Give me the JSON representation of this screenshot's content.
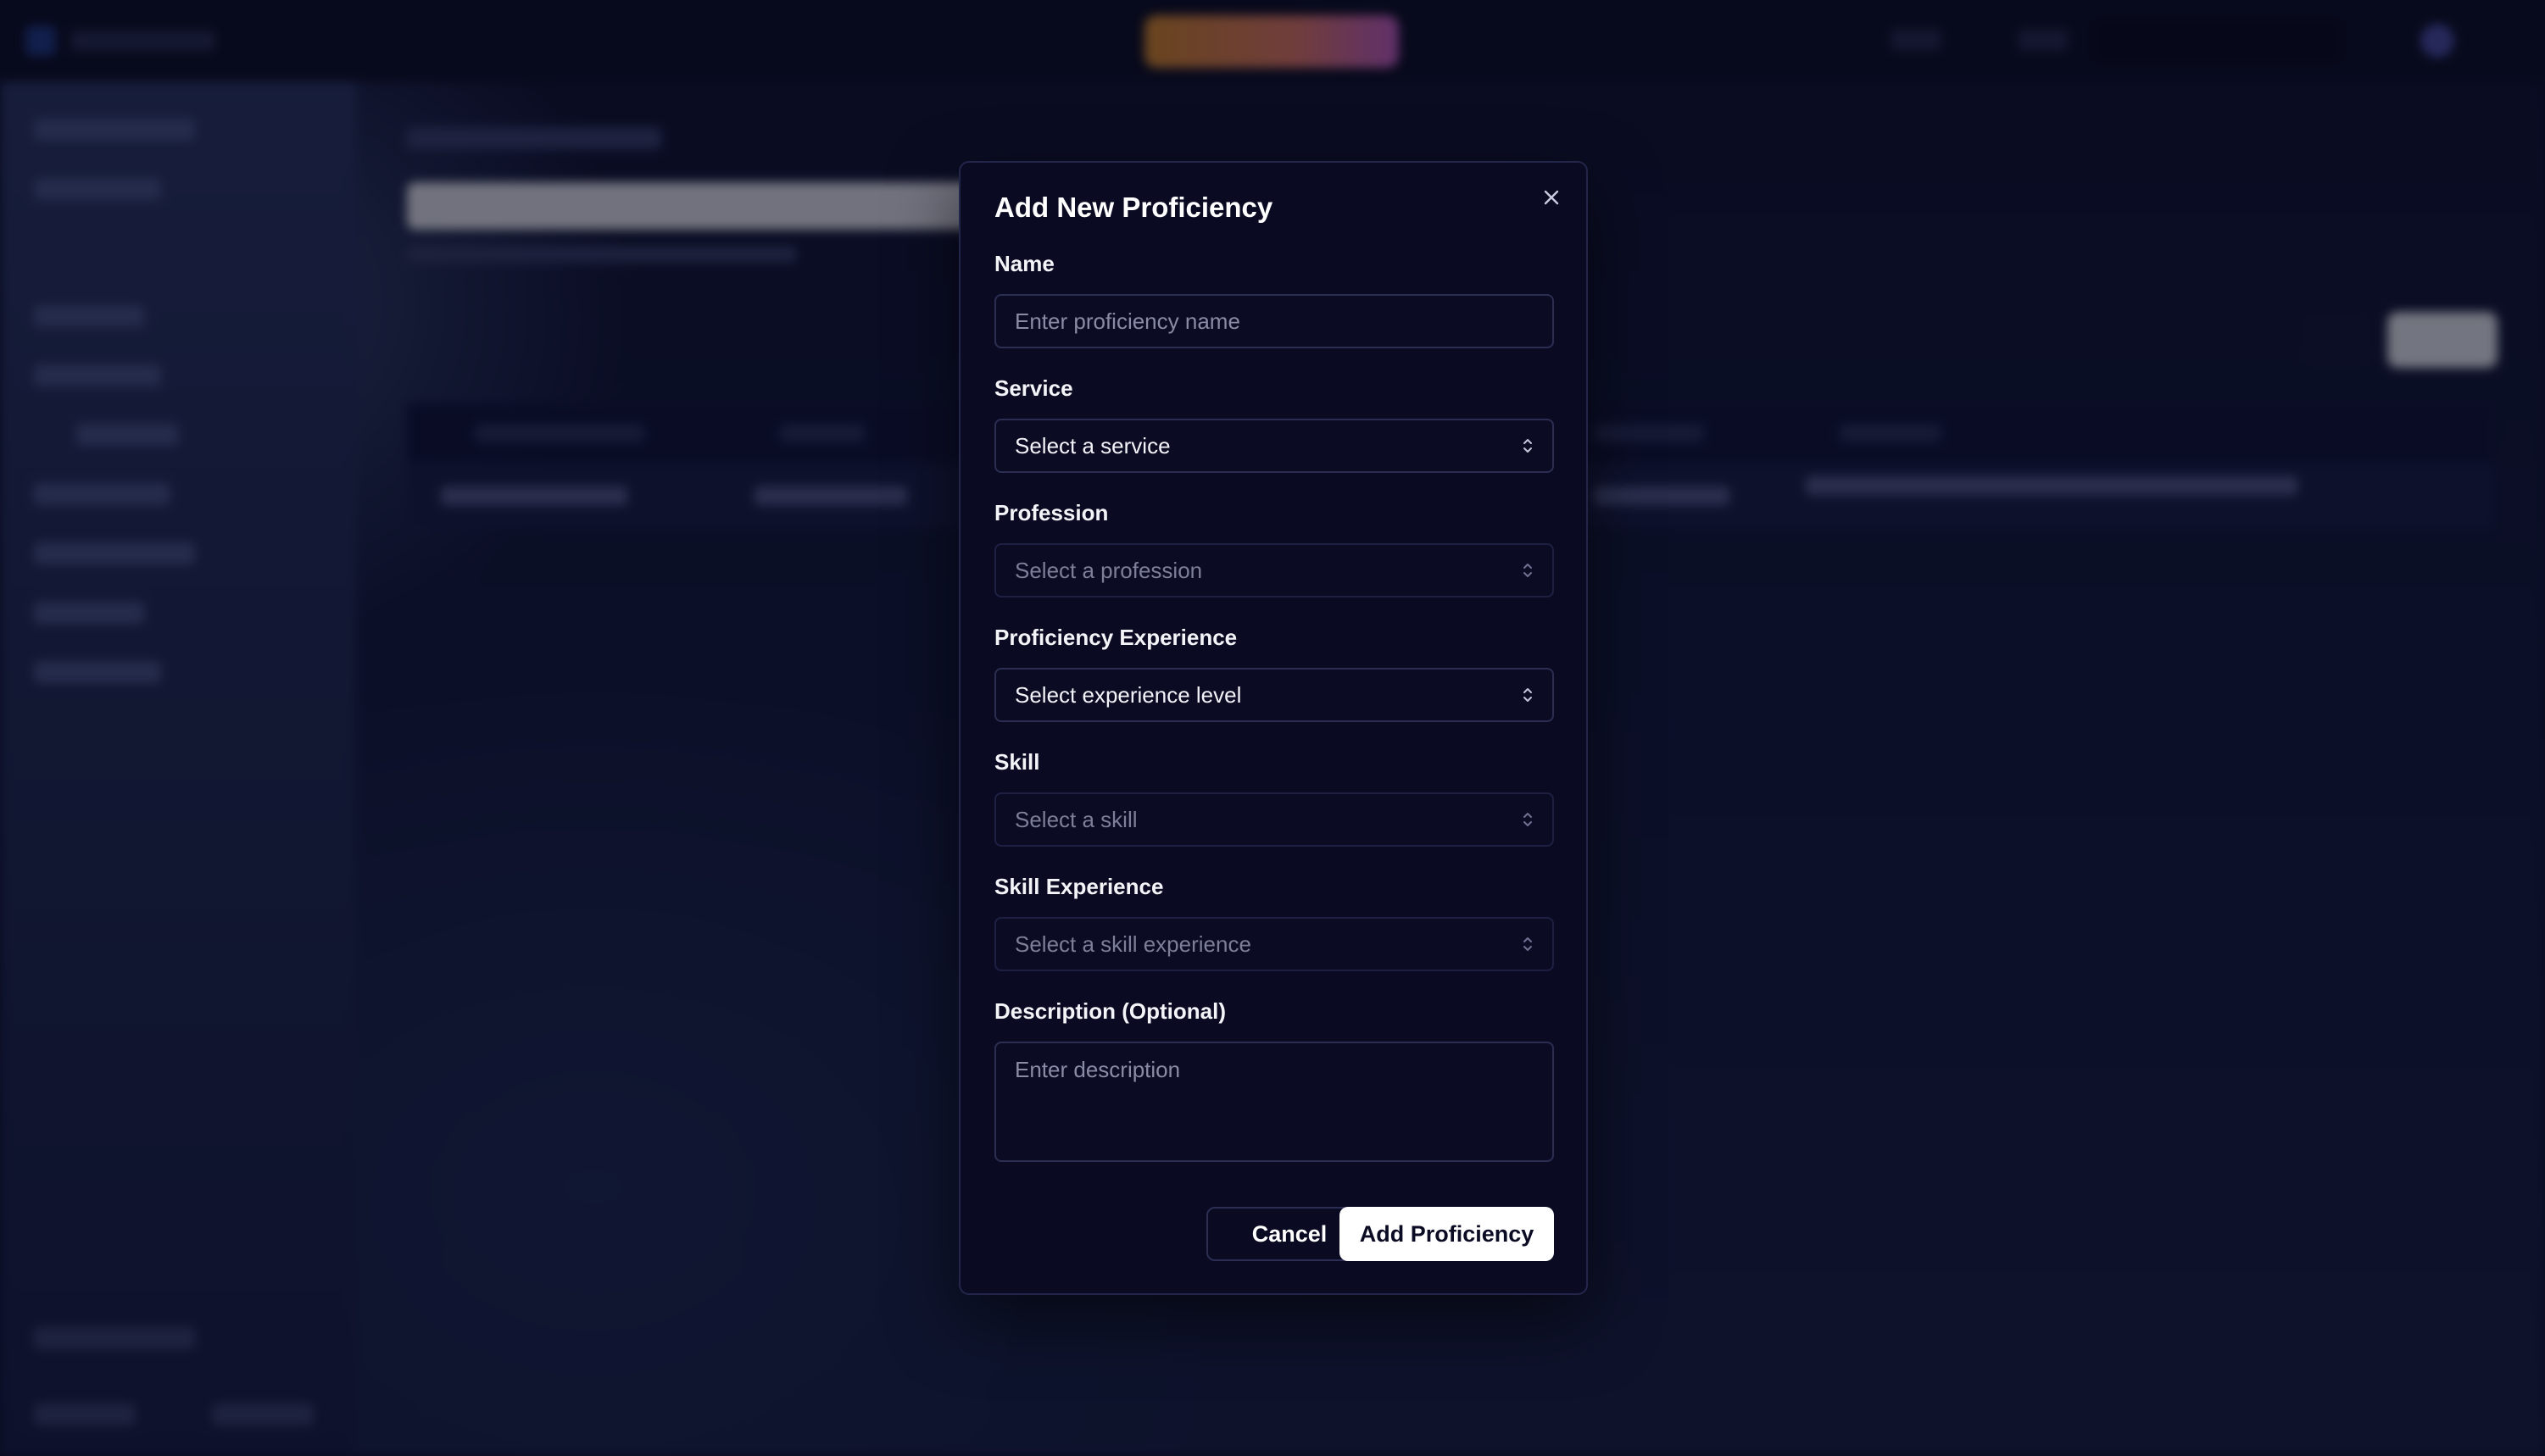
{
  "modal": {
    "title": "Add New Proficiency",
    "close_icon": "close-icon",
    "fields": {
      "name": {
        "label": "Name",
        "placeholder": "Enter proficiency name",
        "value": ""
      },
      "service": {
        "label": "Service",
        "value": "Select a service",
        "state": "enabled"
      },
      "profession": {
        "label": "Profession",
        "value": "Select a profession",
        "state": "disabled"
      },
      "proficiency_experience": {
        "label": "Proficiency Experience",
        "value": "Select experience level",
        "state": "enabled"
      },
      "skill": {
        "label": "Skill",
        "value": "Select a skill",
        "state": "disabled"
      },
      "skill_experience": {
        "label": "Skill Experience",
        "value": "Select a skill experience",
        "state": "disabled"
      },
      "description": {
        "label": "Description (Optional)",
        "placeholder": "Enter description",
        "value": ""
      }
    },
    "buttons": {
      "cancel_label": "Cancel",
      "submit_label": "Add Proficiency"
    }
  },
  "colors": {
    "modal_bg": "#0a0b22",
    "border": "#2b2e52",
    "primary_button_bg": "#ffffff",
    "accent_gradient_start": "#d88a2b",
    "accent_gradient_end": "#c65fc9"
  }
}
